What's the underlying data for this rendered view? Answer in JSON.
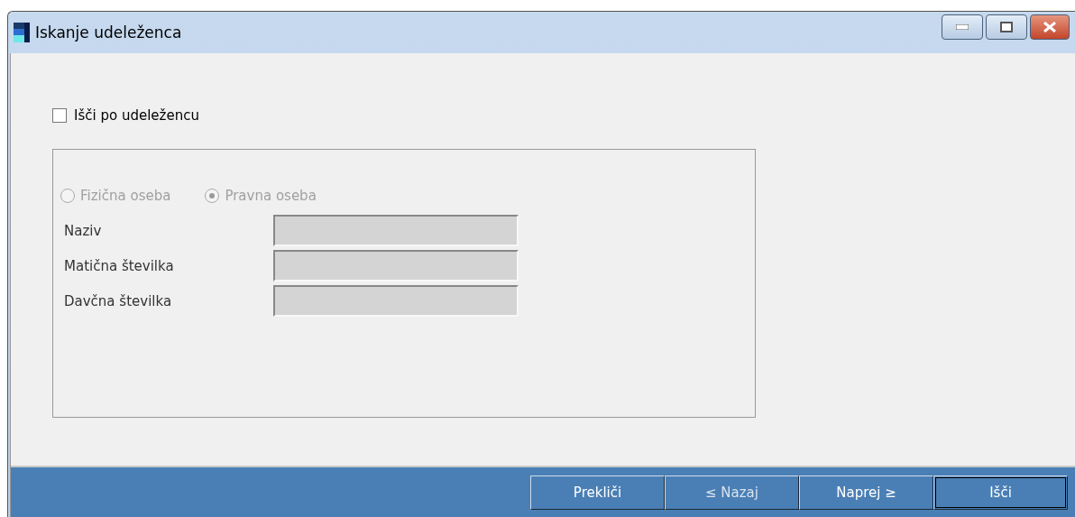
{
  "window": {
    "title": "Iskanje udeleženca"
  },
  "search_by_participant": {
    "label": "Išči po udeležencu",
    "checked": false
  },
  "person_type": [
    {
      "label": "Fizična oseba",
      "selected": false,
      "disabled": true
    },
    {
      "label": "Pravna oseba",
      "selected": true,
      "disabled": true
    }
  ],
  "fields": [
    {
      "label": "Naziv",
      "disabled": true
    },
    {
      "label": "Matična številka",
      "disabled": true
    },
    {
      "label": "Davčna številka",
      "disabled": true
    }
  ],
  "buttons": [
    {
      "label": "Prekliči",
      "disabled": false,
      "default": false
    },
    {
      "label": "≤ Nazaj",
      "disabled": true,
      "default": false
    },
    {
      "label": "Naprej ≥",
      "disabled": false,
      "default": false
    },
    {
      "label": "Išči",
      "disabled": false,
      "default": true
    }
  ]
}
